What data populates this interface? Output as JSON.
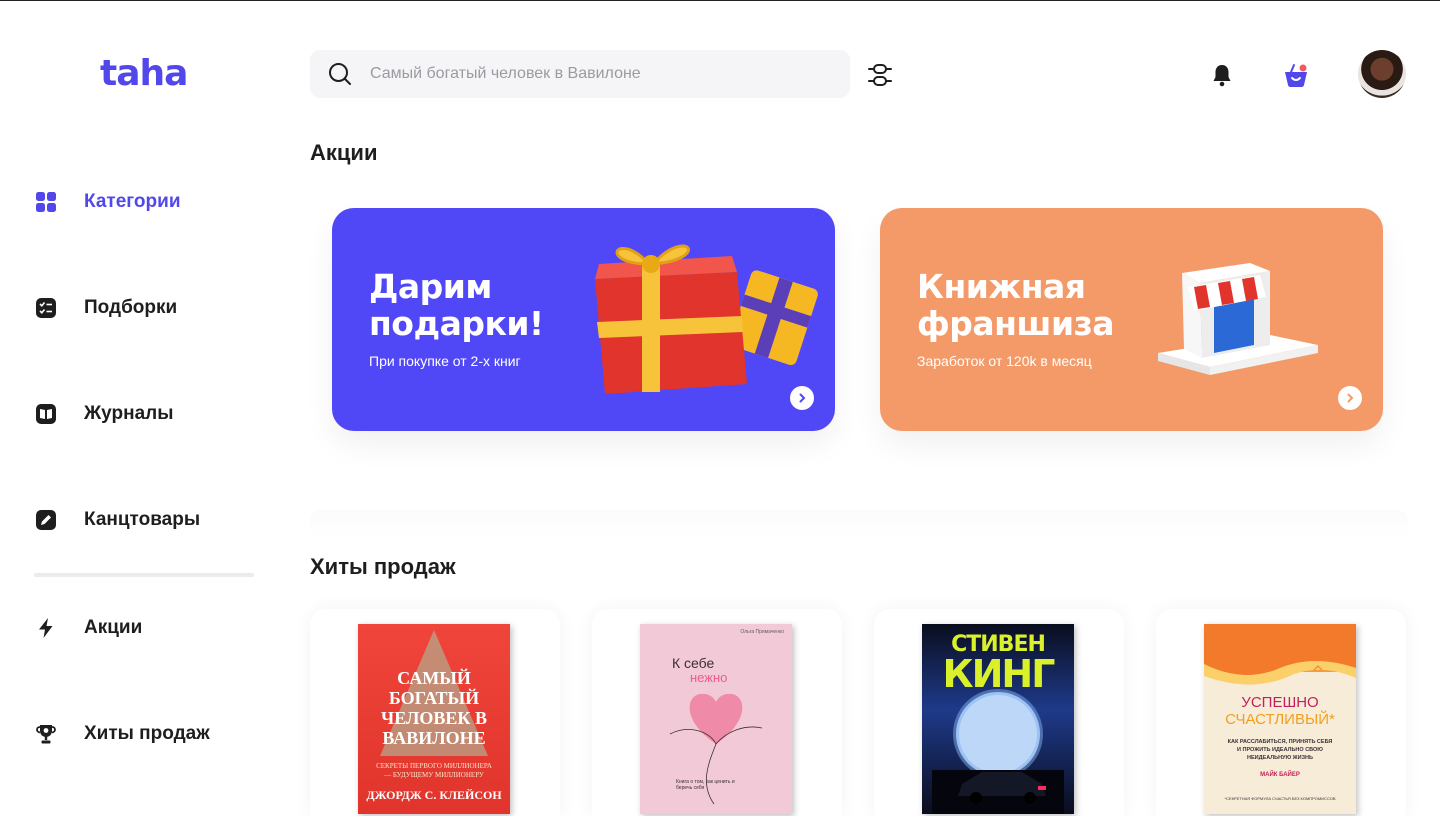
{
  "app": {
    "logo": "taha",
    "brand_color": "#5247ea"
  },
  "search": {
    "placeholder": "Самый богатый человек в Вавилоне",
    "value": ""
  },
  "header": {
    "icons": [
      "search-icon",
      "filter-icon",
      "bell-icon",
      "basket-icon"
    ],
    "basket_badge_color": "#f25b5b"
  },
  "sidebar": {
    "items": [
      {
        "label": "Категории",
        "icon": "grid-icon",
        "active": true
      },
      {
        "label": "Подборки",
        "icon": "checklist-icon",
        "active": false
      },
      {
        "label": "Журналы",
        "icon": "book-open-icon",
        "active": false
      },
      {
        "label": "Канцтовары",
        "icon": "pencil-icon",
        "active": false
      },
      {
        "label": "Акции",
        "icon": "lightning-icon",
        "active": false
      },
      {
        "label": "Хиты продаж",
        "icon": "trophy-icon",
        "active": false
      }
    ]
  },
  "promos": {
    "title": "Акции",
    "cards": [
      {
        "title": "Дарим подарки!",
        "subtitle": "При покупке от 2-х книг",
        "color": "#5048f6",
        "image": "gift-boxes"
      },
      {
        "title": "Книжная франшиза",
        "subtitle": "Заработок от 120k в месяц",
        "color": "#f39a68",
        "image": "shop-stall"
      }
    ]
  },
  "bestsellers": {
    "title": "Хиты продаж",
    "books": [
      {
        "cover_title": "САМЫЙ БОГАТЫЙ ЧЕЛОВЕК В ВАВИЛОНЕ",
        "cover_subtitle": "СЕКРЕТЫ ПЕРВОГО МИЛЛИОНЕРА — БУДУЩЕМУ МИЛЛИОНЕРУ",
        "author": "ДЖОРДЖ С. КЛЕЙСОН"
      },
      {
        "author": "Ольга Примаченко",
        "cover_title": "К себе",
        "cover_title_2": "нежно",
        "cover_subtitle": "Книга о том, как ценить и беречь себя"
      },
      {
        "cover_title": "СТИВЕН",
        "cover_title_2": "КИНГ"
      },
      {
        "cover_title": "УСПЕШНО",
        "cover_title_2": "СЧАСТЛИВЫЙ*",
        "cover_subtitle": "КАК РАССЛАБИТЬСЯ, ПРИНЯТЬ СЕБЯ И ПРОЖИТЬ ИДЕАЛЬНО СВОЮ НЕИДЕАЛЬНУЮ ЖИЗНЬ",
        "author": "МАЙК БАЙЕР",
        "footnote": "*СЕКРЕТНАЯ ФОРМУЛА СЧАСТЬЯ БЕЗ КОМПРОМИССОВ"
      }
    ]
  }
}
